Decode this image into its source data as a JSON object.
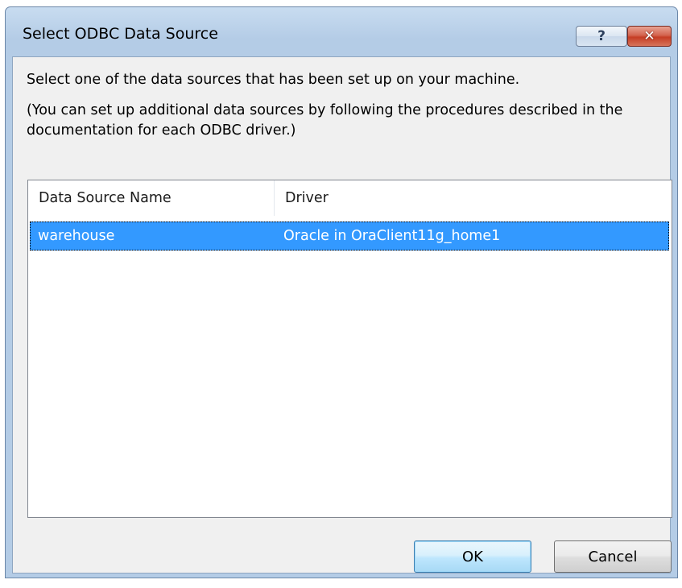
{
  "window": {
    "title": "Select ODBC Data Source",
    "help_glyph": "?",
    "close_glyph": "✕"
  },
  "instructions": {
    "line1": "Select one of the data sources that has been set up on your machine.",
    "line2": "(You can set up additional data sources by following the procedures described in the documentation for each ODBC driver.)"
  },
  "list": {
    "columns": [
      "Data Source Name",
      "Driver"
    ],
    "rows": [
      {
        "name": "warehouse",
        "driver": "Oracle in OraClient11g_home1",
        "selected": true
      }
    ]
  },
  "buttons": {
    "ok": "OK",
    "cancel": "Cancel"
  },
  "colors": {
    "selection": "#3399ff",
    "frame": "#b9d1ea"
  },
  "icons": {
    "help": "help-icon",
    "close": "close-icon"
  }
}
